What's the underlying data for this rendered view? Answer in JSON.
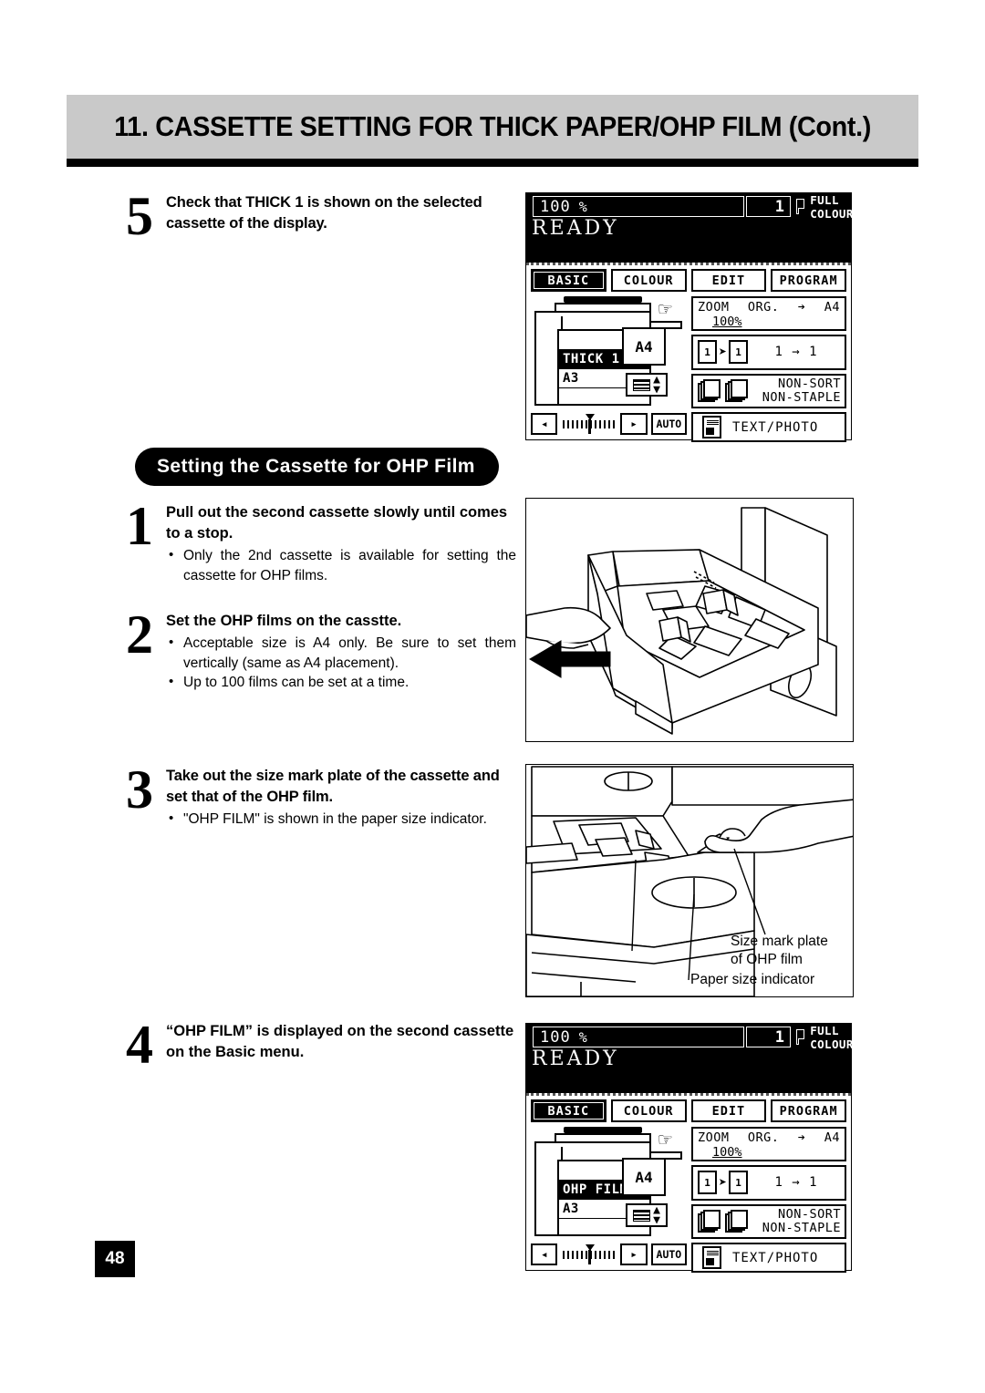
{
  "header": {
    "title": "11. CASSETTE SETTING FOR THICK PAPER/OHP FILM (Cont.)"
  },
  "page_number": "48",
  "section_heading": "Setting the Cassette for OHP Film",
  "steps": [
    {
      "number": "5",
      "title": "Check that THICK 1 is shown on the selected cassette of the display.",
      "bullets": []
    },
    {
      "number": "1",
      "title": "Pull out the second cassette slowly until comes to a stop.",
      "bullets": [
        "Only the 2nd cassette is available for setting the cassette for OHP films."
      ]
    },
    {
      "number": "2",
      "title": "Set the OHP films on the casstte.",
      "bullets": [
        "Acceptable size is A4 only. Be sure to set them vertically (same as A4 placement).",
        "Up to 100 films can be set at a time."
      ]
    },
    {
      "number": "3",
      "title": "Take out the size mark plate of the cassette and set that of the OHP film.",
      "bullets": [
        "\"OHP FILM\" is shown in the paper size indicator."
      ]
    },
    {
      "number": "4",
      "title": "“OHP FILM” is displayed on the second cassette on the Basic menu.",
      "bullets": []
    }
  ],
  "illustration_callouts": {
    "size_mark_plate_line1": "Size mark plate",
    "size_mark_plate_line2": "of OHP film",
    "paper_size_indicator": "Paper size indicator"
  },
  "lcd_top": {
    "ratio_value": "100",
    "ratio_percent": "%",
    "copies": "1",
    "colour_mode": "FULL COLOUR",
    "status": "READY",
    "tabs": [
      {
        "label": "BASIC",
        "active": true
      },
      {
        "label": "COLOUR",
        "active": false
      },
      {
        "label": "EDIT",
        "active": false
      },
      {
        "label": "PROGRAM",
        "active": false
      }
    ],
    "cassettes": [
      {
        "label": "",
        "selected": false
      },
      {
        "label": "THICK 1",
        "selected": true
      },
      {
        "label": "A3",
        "selected": false
      },
      {
        "label": "",
        "selected": false
      }
    ],
    "paper_size": "A4",
    "auto_label": "AUTO",
    "zoom_label": "ZOOM",
    "zoom_org": "ORG.",
    "zoom_arrow": "➔",
    "zoom_dest": "A4",
    "zoom_value": "100%",
    "duplex_label": "1 → 1",
    "duplex_src": "1",
    "duplex_dst": "1",
    "finisher_line1": "NON-SORT",
    "finisher_line2": "NON-STAPLE",
    "mode_label": "TEXT/PHOTO"
  },
  "lcd_bottom": {
    "ratio_value": "100",
    "ratio_percent": "%",
    "copies": "1",
    "colour_mode": "FULL COLOUR",
    "status": "READY",
    "tabs": [
      {
        "label": "BASIC",
        "active": true
      },
      {
        "label": "COLOUR",
        "active": false
      },
      {
        "label": "EDIT",
        "active": false
      },
      {
        "label": "PROGRAM",
        "active": false
      }
    ],
    "cassettes": [
      {
        "label": "",
        "selected": false
      },
      {
        "label": "OHP FILM",
        "selected": true
      },
      {
        "label": "A3",
        "selected": false
      },
      {
        "label": "",
        "selected": false
      }
    ],
    "paper_size": "A4",
    "auto_label": "AUTO",
    "zoom_label": "ZOOM",
    "zoom_org": "ORG.",
    "zoom_arrow": "➔",
    "zoom_dest": "A4",
    "zoom_value": "100%",
    "duplex_label": "1 → 1",
    "duplex_src": "1",
    "duplex_dst": "1",
    "finisher_line1": "NON-SORT",
    "finisher_line2": "NON-STAPLE",
    "mode_label": "TEXT/PHOTO"
  }
}
